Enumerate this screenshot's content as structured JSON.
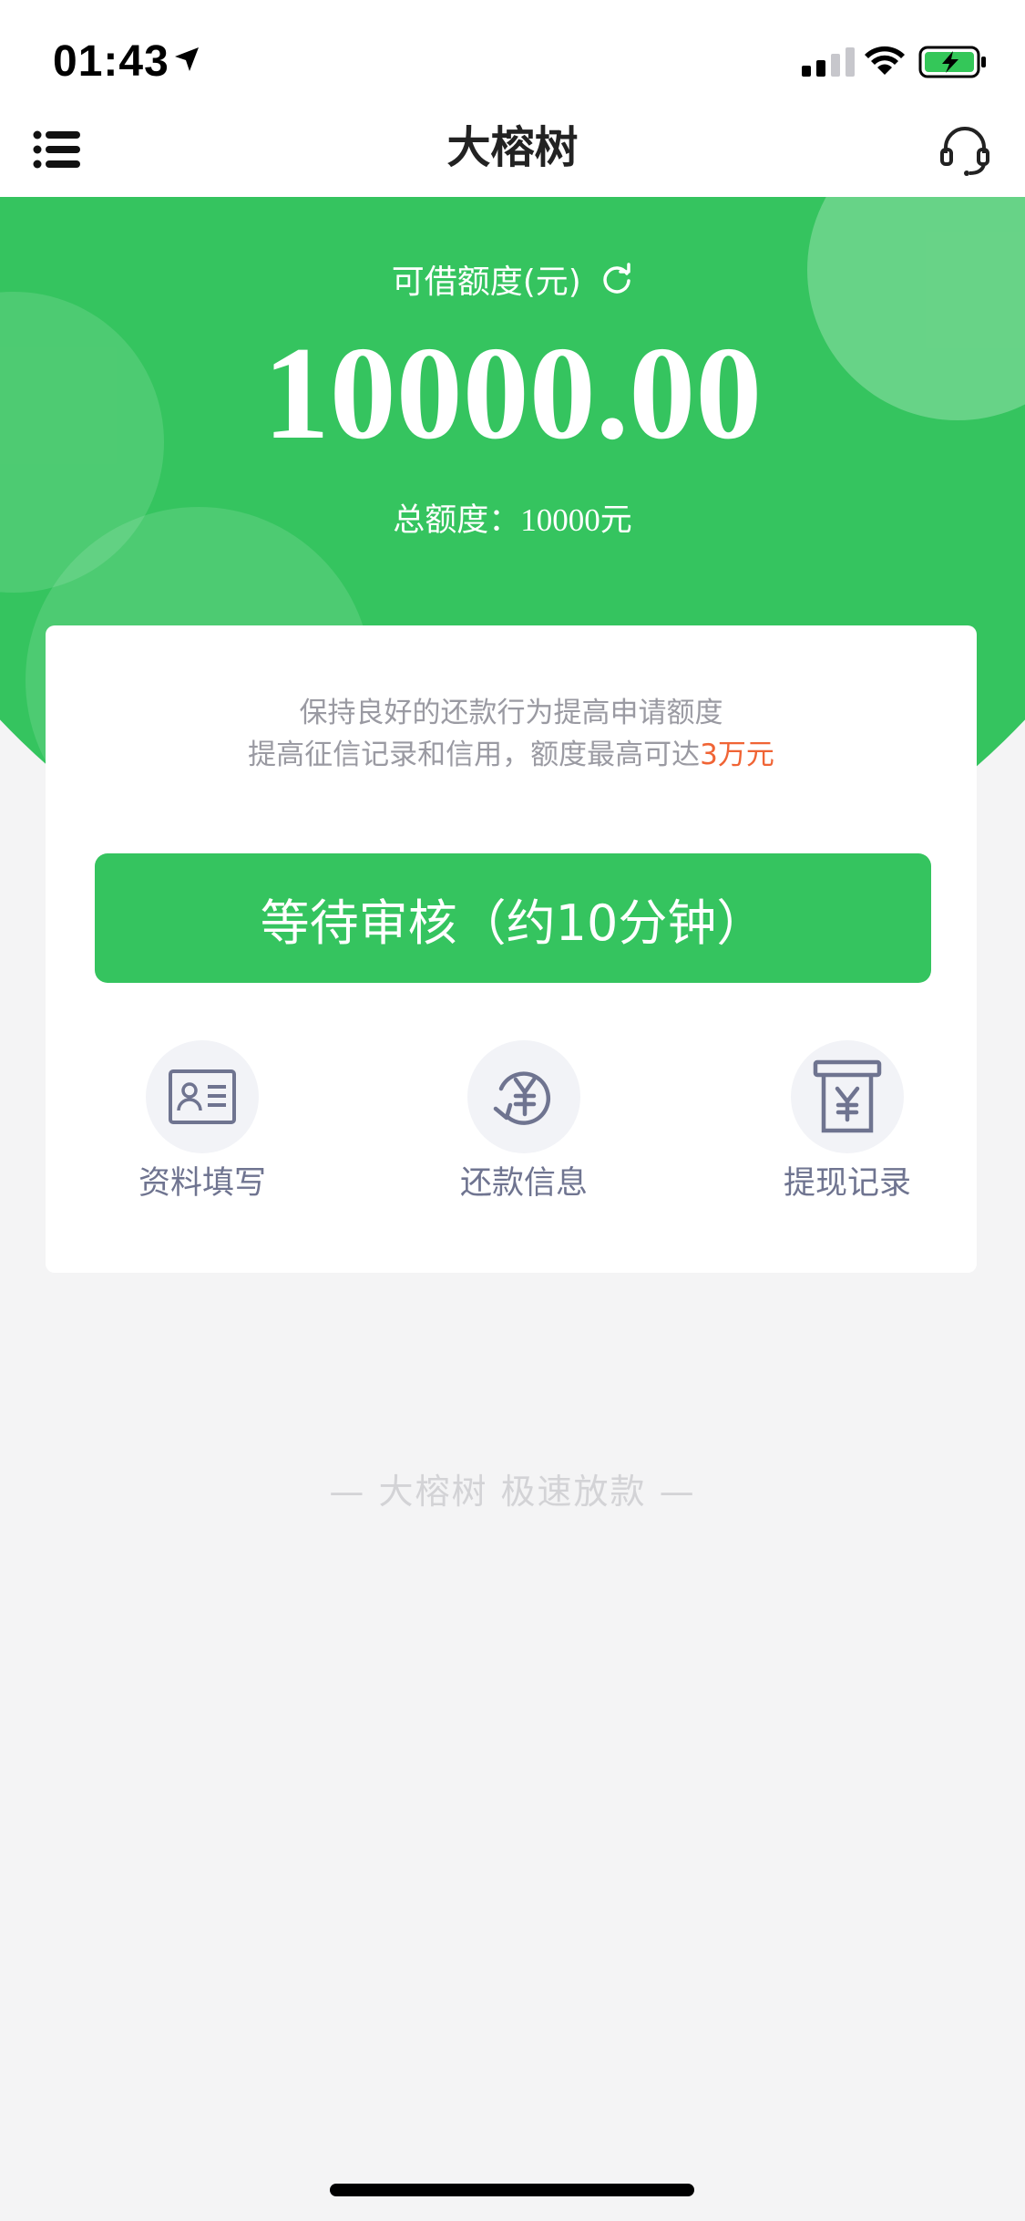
{
  "status_bar": {
    "time": "01:43"
  },
  "header": {
    "title": "大榕树"
  },
  "credit": {
    "label": "可借额度(元)",
    "amount": "10000.00",
    "total_label": "总额度：",
    "total_value": "10000元"
  },
  "card": {
    "tip_line1": "保持良好的还款行为提高申请额度",
    "tip_line2_prefix": "提高征信记录和信用，额度最高可达",
    "tip_line2_highlight": "3万元",
    "primary_button": "等待审核（约10分钟）",
    "quick_actions": [
      {
        "label": "资料填写",
        "icon": "id-card-icon"
      },
      {
        "label": "还款信息",
        "icon": "yuan-cycle-icon"
      },
      {
        "label": "提现记录",
        "icon": "yuan-receipt-icon"
      }
    ]
  },
  "footer": {
    "slogan": "— 大榕树  极速放款 —"
  },
  "colors": {
    "brand_green": "#35c45f",
    "highlight_orange": "#f06435",
    "icon_gray": "#6f7490"
  }
}
